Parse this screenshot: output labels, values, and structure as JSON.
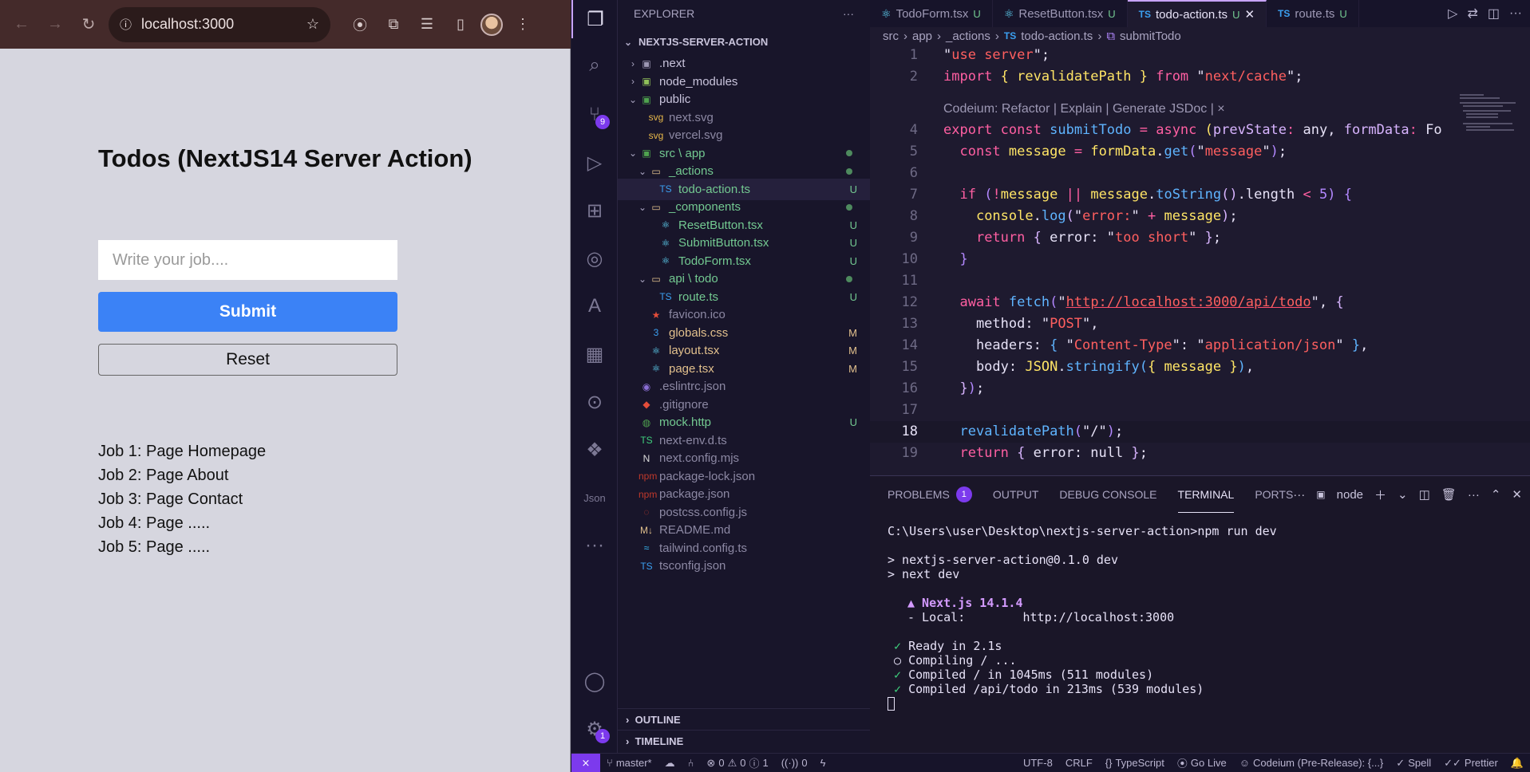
{
  "browser": {
    "url": "localhost:3000",
    "page": {
      "title": "Todos (NextJS14 Server Action)",
      "input_placeholder": "Write your job....",
      "submit_label": "Submit",
      "reset_label": "Reset",
      "jobs": [
        "Job 1: Page Homepage",
        "Job 2: Page About",
        "Job 3: Page Contact",
        "Job 4: Page .....",
        "Job 5: Page ....."
      ]
    }
  },
  "vscode": {
    "explorer_title": "EXPLORER",
    "project": "NEXTJS-SERVER-ACTION",
    "scm_badge": "9",
    "accounts_badge": "1",
    "tree": [
      {
        "label": ".next",
        "status": "",
        "color": "default"
      },
      {
        "label": "node_modules",
        "status": "",
        "color": "default"
      },
      {
        "label": "public",
        "status": "",
        "color": "default"
      },
      {
        "label": "next.svg",
        "status": "",
        "color": "dim"
      },
      {
        "label": "vercel.svg",
        "status": "",
        "color": "dim"
      },
      {
        "label": "src \\ app",
        "status": "",
        "color": "green"
      },
      {
        "label": "_actions",
        "status": "",
        "color": "green"
      },
      {
        "label": "todo-action.ts",
        "status": "U",
        "color": "green"
      },
      {
        "label": "_components",
        "status": "",
        "color": "green"
      },
      {
        "label": "ResetButton.tsx",
        "status": "U",
        "color": "green"
      },
      {
        "label": "SubmitButton.tsx",
        "status": "U",
        "color": "green"
      },
      {
        "label": "TodoForm.tsx",
        "status": "U",
        "color": "green"
      },
      {
        "label": "api \\ todo",
        "status": "",
        "color": "green"
      },
      {
        "label": "route.ts",
        "status": "U",
        "color": "green"
      },
      {
        "label": "favicon.ico",
        "status": "",
        "color": "dim"
      },
      {
        "label": "globals.css",
        "status": "M",
        "color": "yellow"
      },
      {
        "label": "layout.tsx",
        "status": "M",
        "color": "yellow"
      },
      {
        "label": "page.tsx",
        "status": "M",
        "color": "yellow"
      },
      {
        "label": ".eslintrc.json",
        "status": "",
        "color": "dim"
      },
      {
        "label": ".gitignore",
        "status": "",
        "color": "dim"
      },
      {
        "label": "mock.http",
        "status": "U",
        "color": "green"
      },
      {
        "label": "next-env.d.ts",
        "status": "",
        "color": "dim"
      },
      {
        "label": "next.config.mjs",
        "status": "",
        "color": "dim"
      },
      {
        "label": "package-lock.json",
        "status": "",
        "color": "dim"
      },
      {
        "label": "package.json",
        "status": "",
        "color": "dim"
      },
      {
        "label": "postcss.config.js",
        "status": "",
        "color": "dim"
      },
      {
        "label": "README.md",
        "status": "",
        "color": "dim"
      },
      {
        "label": "tailwind.config.ts",
        "status": "",
        "color": "dim"
      },
      {
        "label": "tsconfig.json",
        "status": "",
        "color": "dim"
      }
    ],
    "outline_label": "OUTLINE",
    "timeline_label": "TIMELINE",
    "tabs": [
      {
        "label": "TodoForm.tsx",
        "status": "U"
      },
      {
        "label": "ResetButton.tsx",
        "status": "U"
      },
      {
        "label": "todo-action.ts",
        "status": "U"
      },
      {
        "label": "route.ts",
        "status": "U"
      }
    ],
    "breadcrumb": [
      "src",
      "app",
      "_actions",
      "todo-action.ts",
      "submitTodo"
    ],
    "codelens": "Codeium: Refactor | Explain | Generate JSDoc | ×",
    "line_numbers": [
      "1",
      "2",
      "",
      "4",
      "5",
      "6",
      "7",
      "8",
      "9",
      "10",
      "11",
      "12",
      "13",
      "14",
      "15",
      "16",
      "17",
      "18",
      "19"
    ],
    "panel_tabs": [
      "PROBLEMS",
      "OUTPUT",
      "DEBUG CONSOLE",
      "TERMINAL",
      "PORTS"
    ],
    "problems_count": "1",
    "terminal_name": "node",
    "terminal": {
      "prompt": "C:\\Users\\user\\Desktop\\nextjs-server-action>npm run dev",
      "l1": "> nextjs-server-action@0.1.0 dev",
      "l2": "> next dev",
      "next": "▲ Next.js 14.1.4",
      "local": "- Local:        http://localhost:3000",
      "ready": "Ready in 2.1s",
      "compiling": "Compiling / ...",
      "compiled1": "Compiled / in 1045ms (511 modules)",
      "compiled2": "Compiled /api/todo in 213ms (539 modules)"
    },
    "status": {
      "branch": "master*",
      "errors": "0",
      "warnings": "0",
      "info": "1",
      "ports": "0",
      "encoding": "UTF-8",
      "eol": "CRLF",
      "language": "TypeScript",
      "golive": "Go Live",
      "codeium": "Codeium (Pre-Release): {...}",
      "spell": "Spell",
      "prettier": "Prettier"
    }
  },
  "colors": {
    "accent": "#7c3aed",
    "submit": "#3b82f6",
    "chrome": "#442a2a"
  }
}
